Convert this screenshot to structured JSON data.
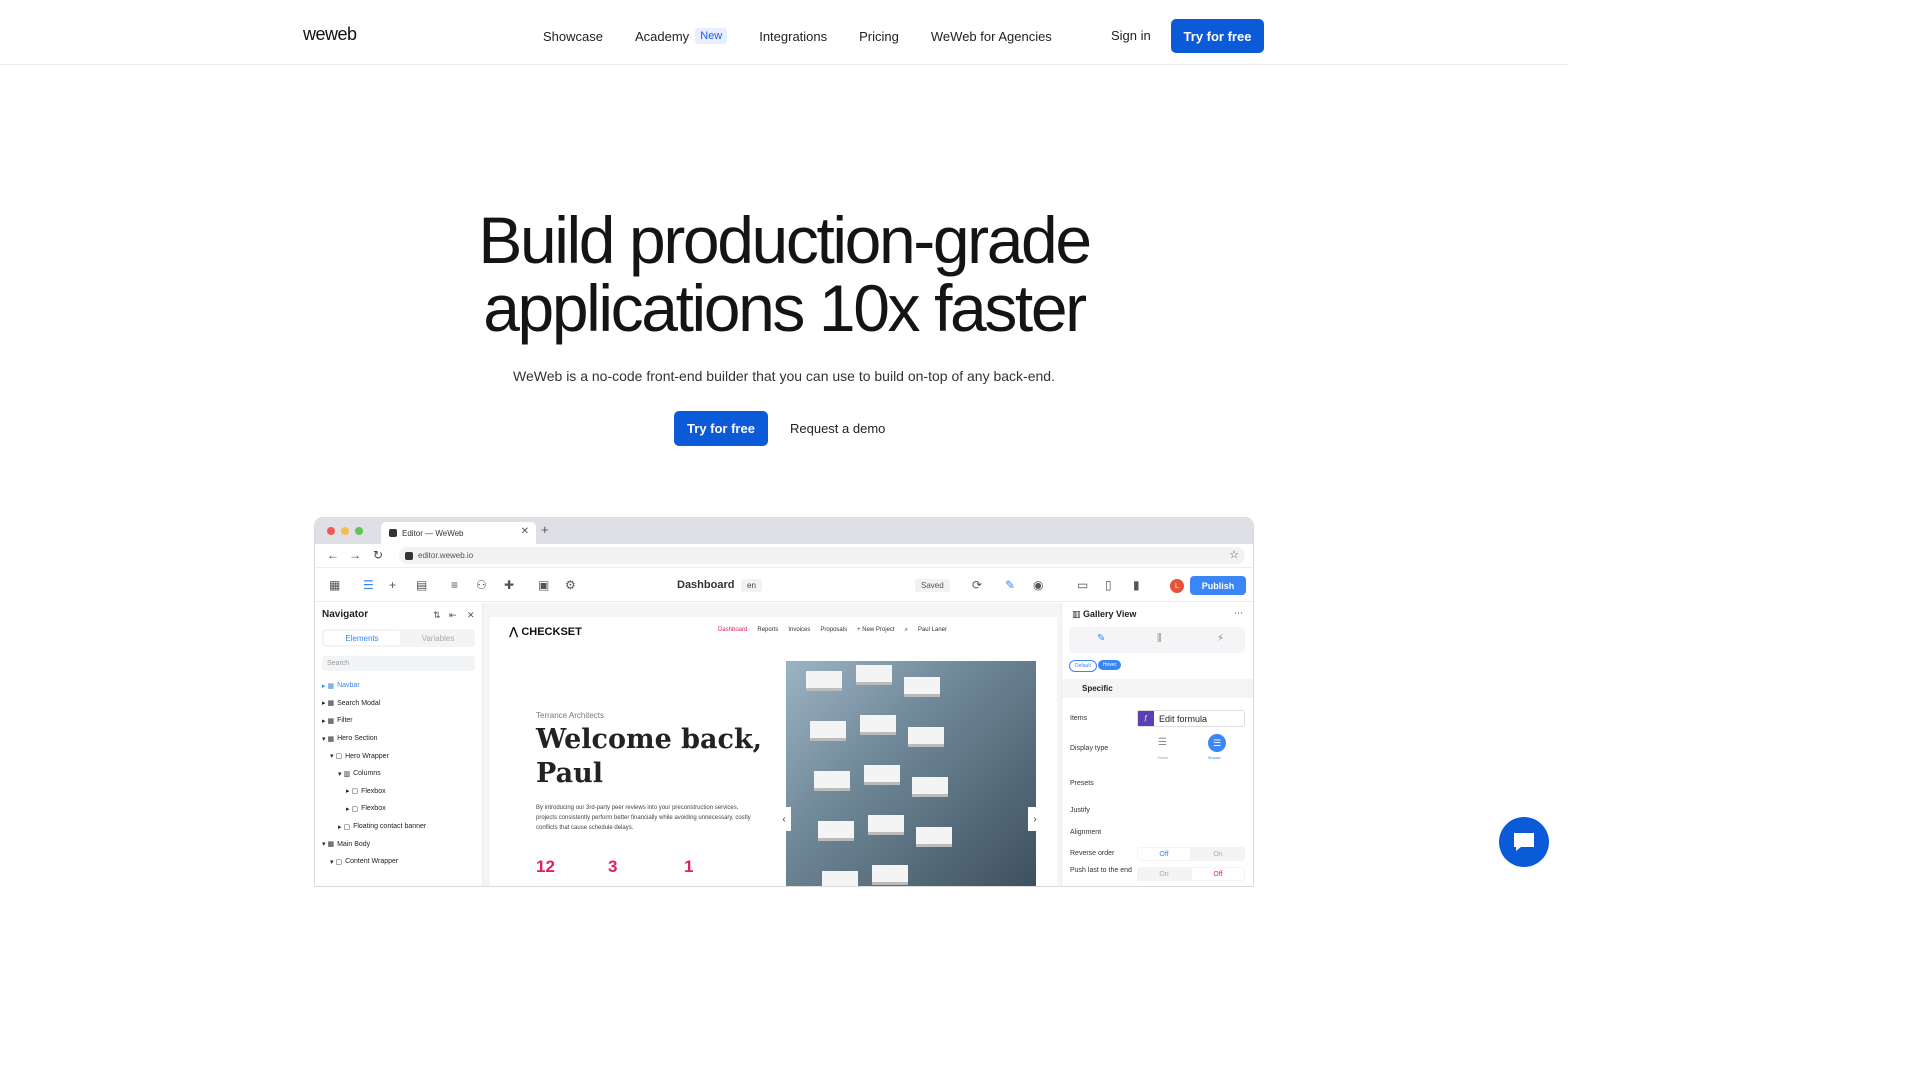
{
  "nav": {
    "logo": "weweb",
    "items": [
      "Showcase",
      "Academy",
      "Integrations",
      "Pricing",
      "WeWeb for Agencies"
    ],
    "academy_badge": "New",
    "signin": "Sign in",
    "cta": "Try for free"
  },
  "hero": {
    "title_line1": "Build production-grade",
    "title_line2": "applications 10x faster",
    "subtitle": "WeWeb is a no-code front-end builder that you can use to build on-top of any back-end.",
    "cta_primary": "Try for free",
    "cta_secondary": "Request a demo"
  },
  "browser": {
    "tab_title": "Editor — WeWeb",
    "url": "editor.weweb.io"
  },
  "editor": {
    "page_name": "Dashboard",
    "lang": "en",
    "saved": "Saved",
    "publish": "Publish",
    "avatar": "L",
    "navigator": {
      "title": "Navigator",
      "tab_elements": "Elements",
      "tab_variables": "Variables",
      "search": "Search",
      "tree": [
        "Navbar",
        "Search Modal",
        "Filter",
        "Hero Section",
        "Hero Wrapper",
        "Columns",
        "Flexbox",
        "Flexbox",
        "Floating contact banner",
        "Main Body",
        "Content Wrapper"
      ]
    },
    "site": {
      "logo": "CHECKSET",
      "menu": [
        "Dashboard",
        "Reports",
        "Invoices",
        "Proposals",
        "+ New Project",
        "Paul Laner"
      ],
      "architect": "Terrance Architects",
      "welcome": "Welcome back, Paul",
      "body": "By introducing our 3rd-party peer reviews into your preconstruction services, projects consistently perform better financially while avoiding unnecessary, costly conflicts that cause schedule delays.",
      "stats": [
        "12",
        "3",
        "1"
      ]
    },
    "props": {
      "title": "Gallery View",
      "state_default": "Default",
      "state_hover": "Hover",
      "section": "Specific",
      "items_label": "Items",
      "formula": "Edit formula",
      "display_label": "Display type",
      "display_rows": "Rows",
      "display_mosaic": "Mosaic",
      "presets_label": "Presets",
      "justify_label": "Justify",
      "alignment_label": "Alignment",
      "reverse_label": "Reverse order",
      "reverse_off": "Off",
      "reverse_on": "On",
      "push_label": "Push last to the end",
      "push_on": "On",
      "push_off": "Off"
    }
  },
  "colors": {
    "primary": "#0b5ad8",
    "accent": "#e0215d",
    "editor_blue": "#3a86f6"
  }
}
